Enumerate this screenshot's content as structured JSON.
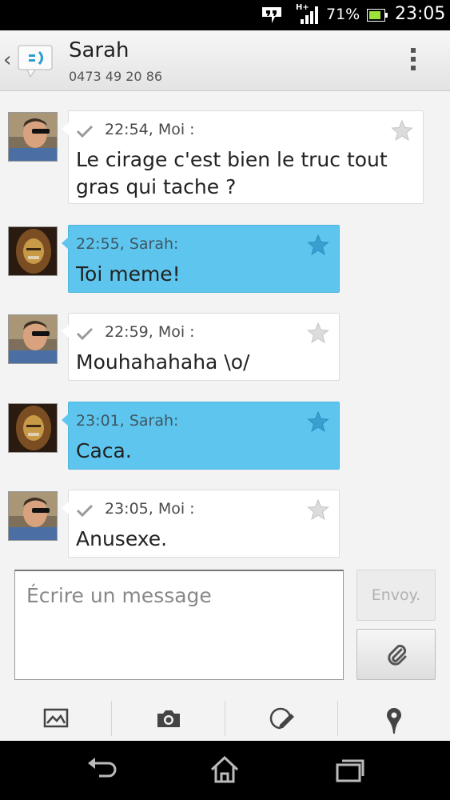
{
  "status_bar": {
    "network_type": "H+",
    "battery_percent": "71%",
    "time": "23:05",
    "icons": [
      "hangouts-icon",
      "signal-icon",
      "battery-icon"
    ]
  },
  "header": {
    "contact_name": "Sarah",
    "contact_number": "0473 49 20 86",
    "icons": [
      "back-chevron-icon",
      "messaging-app-icon",
      "overflow-menu-icon"
    ]
  },
  "messages": [
    {
      "direction": "out",
      "time_sender": "22:54, Moi :",
      "text_lines": [
        "Le cirage c'est bien le truc tout",
        "gras qui tache ?"
      ],
      "starred": false
    },
    {
      "direction": "in",
      "time_sender": "22:55, Sarah:",
      "text_lines": [
        "Toi meme!"
      ],
      "starred": true
    },
    {
      "direction": "out",
      "time_sender": "22:59, Moi :",
      "text_lines": [
        "Mouhahahaha \\o/"
      ],
      "starred": false
    },
    {
      "direction": "in",
      "time_sender": "23:01, Sarah:",
      "text_lines": [
        "Caca."
      ],
      "starred": true
    },
    {
      "direction": "out",
      "time_sender": "23:05, Moi :",
      "text_lines": [
        "Anusexe."
      ],
      "starred": false
    }
  ],
  "composer": {
    "placeholder": "Écrire un message",
    "send_label": "Envoy."
  },
  "attach_toolbar": {
    "items": [
      "picture-icon",
      "camera-icon",
      "sketch-icon",
      "location-pin-icon"
    ]
  },
  "navbar": {
    "items": [
      "back-icon",
      "home-icon",
      "recent-apps-icon"
    ]
  },
  "colors": {
    "incoming_bubble": "#5ec6ee",
    "outgoing_bubble": "#ffffff",
    "star_active": "#3a9fd0",
    "star_inactive": "#cfcfcf"
  }
}
